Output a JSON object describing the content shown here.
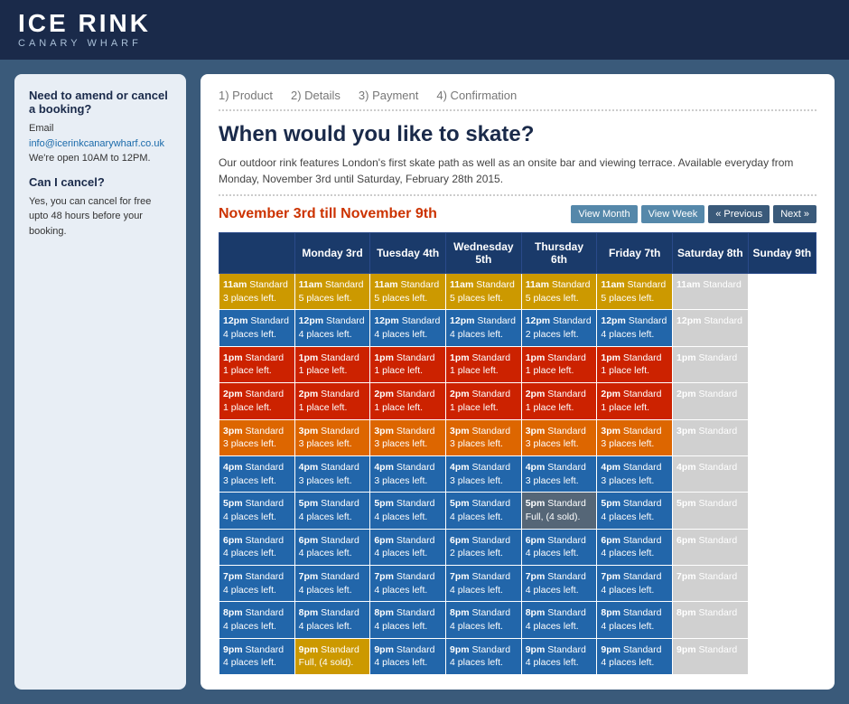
{
  "header": {
    "logo_line1": "ICE RINK",
    "logo_line2": "CANARY WHARF"
  },
  "sidebar": {
    "amend_title": "Need to amend or cancel a booking?",
    "email_label": "Email",
    "email_value": "info@icerinkcanarywharf.co.uk",
    "hours": "We're open 10AM to 12PM.",
    "cancel_title": "Can I cancel?",
    "cancel_text": "Yes, you can cancel for free upto 48 hours before your booking."
  },
  "steps": [
    {
      "num": "1)",
      "label": "Product"
    },
    {
      "num": "2)",
      "label": "Details"
    },
    {
      "num": "3)",
      "label": "Payment"
    },
    {
      "num": "4)",
      "label": "Confirmation"
    }
  ],
  "page_heading": "When would you like to skate?",
  "description": "Our outdoor rink features London's first skate path as well as an onsite bar and viewing terrace. Available everyday from Monday, November 3rd until Saturday, February 28th 2015.",
  "week_title": "November 3rd till November 9th",
  "view_month": "View Month",
  "view_week": "View Week",
  "prev": "« Previous",
  "next": "Next »",
  "days": [
    {
      "label": "Monday 3rd"
    },
    {
      "label": "Tuesday 4th"
    },
    {
      "label": "Wednesday\n5th"
    },
    {
      "label": "Thursday\n6th"
    },
    {
      "label": "Friday 7th"
    },
    {
      "label": "Saturday 8th"
    },
    {
      "label": "Sunday 9th"
    }
  ],
  "slots": [
    {
      "time": "11am",
      "type": "Standard",
      "entries": [
        {
          "text": "3 places left.",
          "color": "yellow"
        },
        {
          "text": "5 places left.",
          "color": "yellow"
        },
        {
          "text": "5 places left.",
          "color": "yellow"
        },
        {
          "text": "5 places left.",
          "color": "yellow"
        },
        {
          "text": "5 places left.",
          "color": "yellow"
        },
        {
          "text": "5 places left.",
          "color": "yellow"
        },
        {
          "text": "",
          "color": "gray"
        }
      ]
    },
    {
      "time": "12pm",
      "type": "Standard",
      "entries": [
        {
          "text": "4 places left.",
          "color": "blue"
        },
        {
          "text": "4 places left.",
          "color": "blue"
        },
        {
          "text": "4 places left.",
          "color": "blue"
        },
        {
          "text": "4 places left.",
          "color": "blue"
        },
        {
          "text": "2 places left.",
          "color": "blue"
        },
        {
          "text": "4 places left.",
          "color": "blue"
        },
        {
          "text": "",
          "color": "gray"
        }
      ]
    },
    {
      "time": "1pm",
      "type": "Standard",
      "entries": [
        {
          "text": "1 place left.",
          "color": "red"
        },
        {
          "text": "1 place left.",
          "color": "red"
        },
        {
          "text": "1 place left.",
          "color": "red"
        },
        {
          "text": "1 place left.",
          "color": "red"
        },
        {
          "text": "1 place left.",
          "color": "red"
        },
        {
          "text": "1 place left.",
          "color": "red"
        },
        {
          "text": "",
          "color": "gray"
        }
      ]
    },
    {
      "time": "2pm",
      "type": "Standard",
      "entries": [
        {
          "text": "1 place left.",
          "color": "red"
        },
        {
          "text": "1 place left.",
          "color": "red"
        },
        {
          "text": "1 place left.",
          "color": "red"
        },
        {
          "text": "1 place left.",
          "color": "red"
        },
        {
          "text": "1 place left.",
          "color": "red"
        },
        {
          "text": "1 place left.",
          "color": "red"
        },
        {
          "text": "",
          "color": "gray"
        }
      ]
    },
    {
      "time": "3pm",
      "type": "Standard",
      "entries": [
        {
          "text": "3 places left.",
          "color": "orange"
        },
        {
          "text": "3 places left.",
          "color": "orange"
        },
        {
          "text": "3 places left.",
          "color": "orange"
        },
        {
          "text": "3 places left.",
          "color": "orange"
        },
        {
          "text": "3 places left.",
          "color": "orange"
        },
        {
          "text": "3 places left.",
          "color": "orange"
        },
        {
          "text": "",
          "color": "gray"
        }
      ]
    },
    {
      "time": "4pm",
      "type": "Standard",
      "entries": [
        {
          "text": "3 places left.",
          "color": "blue"
        },
        {
          "text": "3 places left.",
          "color": "blue"
        },
        {
          "text": "3 places left.",
          "color": "blue"
        },
        {
          "text": "3 places left.",
          "color": "blue"
        },
        {
          "text": "3 places left.",
          "color": "blue"
        },
        {
          "text": "3 places left.",
          "color": "blue"
        },
        {
          "text": "",
          "color": "gray"
        }
      ]
    },
    {
      "time": "5pm",
      "type": "Standard",
      "entries": [
        {
          "text": "4 places left.",
          "color": "blue"
        },
        {
          "text": "4 places left.",
          "color": "blue"
        },
        {
          "text": "4 places left.",
          "color": "blue"
        },
        {
          "text": "4 places left.",
          "color": "blue"
        },
        {
          "text": "Full, (4 sold).",
          "color": "darkgray"
        },
        {
          "text": "4 places left.",
          "color": "blue"
        },
        {
          "text": "",
          "color": "gray"
        }
      ]
    },
    {
      "time": "6pm",
      "type": "Standard",
      "entries": [
        {
          "text": "4 places left.",
          "color": "blue"
        },
        {
          "text": "4 places left.",
          "color": "blue"
        },
        {
          "text": "4 places left.",
          "color": "blue"
        },
        {
          "text": "2 places left.",
          "color": "blue"
        },
        {
          "text": "4 places left.",
          "color": "blue"
        },
        {
          "text": "4 places left.",
          "color": "blue"
        },
        {
          "text": "",
          "color": "gray"
        }
      ]
    },
    {
      "time": "7pm",
      "type": "Standard",
      "entries": [
        {
          "text": "4 places left.",
          "color": "blue"
        },
        {
          "text": "4 places left.",
          "color": "blue"
        },
        {
          "text": "4 places left.",
          "color": "blue"
        },
        {
          "text": "4 places left.",
          "color": "blue"
        },
        {
          "text": "4 places left.",
          "color": "blue"
        },
        {
          "text": "4 places left.",
          "color": "blue"
        },
        {
          "text": "",
          "color": "gray"
        }
      ]
    },
    {
      "time": "8pm",
      "type": "Standard",
      "entries": [
        {
          "text": "4 places left.",
          "color": "blue"
        },
        {
          "text": "4 places left.",
          "color": "blue"
        },
        {
          "text": "4 places left.",
          "color": "blue"
        },
        {
          "text": "4 places left.",
          "color": "blue"
        },
        {
          "text": "4 places left.",
          "color": "blue"
        },
        {
          "text": "4 places left.",
          "color": "blue"
        },
        {
          "text": "",
          "color": "gray"
        }
      ]
    },
    {
      "time": "9pm",
      "type": "Standard",
      "entries": [
        {
          "text": "4 places left.",
          "color": "blue"
        },
        {
          "text": "Full, (4 sold).",
          "color": "yellow"
        },
        {
          "text": "4 places left.",
          "color": "blue"
        },
        {
          "text": "4 places left.",
          "color": "blue"
        },
        {
          "text": "4 places left.",
          "color": "blue"
        },
        {
          "text": "4 places left.",
          "color": "blue"
        },
        {
          "text": "",
          "color": "gray"
        }
      ]
    }
  ]
}
